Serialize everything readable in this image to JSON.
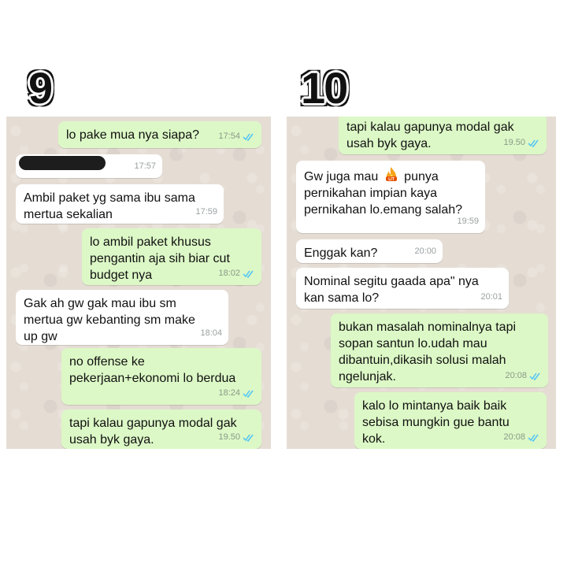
{
  "panels": [
    {
      "number": "9",
      "messages": [
        {
          "dir": "out",
          "text": "lo pake mua nya siapa?",
          "time": "17:54",
          "ticks": true
        },
        {
          "dir": "in",
          "text": "",
          "time": "17:57",
          "redacted": true
        },
        {
          "dir": "in",
          "text": "Ambil paket yg sama ibu sama\nmertua sekalian",
          "time": "17:59"
        },
        {
          "dir": "out",
          "text": "lo ambil paket khusus\npengantin aja sih biar cut\nbudget nya",
          "time": "18:02",
          "ticks": true
        },
        {
          "dir": "in",
          "text": "Gak ah gw gak mau ibu sm\nmertua gw kebanting sm make\nup gw",
          "time": "18:04"
        },
        {
          "dir": "out",
          "text": "no offense ke\npekerjaan+ekonomi lo berdua",
          "time": "18:24",
          "ticks": true
        },
        {
          "dir": "out",
          "text": "tapi kalau gapunya modal gak\nusah byk gaya.",
          "time": "19.50",
          "ticks": true
        }
      ]
    },
    {
      "number": "10",
      "messages": [
        {
          "dir": "out",
          "text": "tapi kalau gapunya modal gak\nusah byk gaya.",
          "time": "19.50",
          "ticks": true
        },
        {
          "dir": "in",
          "text_before_icon": "Gw juga mau ",
          "icon": "lit-fire-icon",
          "text_after_icon": " punya\npernikahan impian kaya\npernikahan lo.emang salah?",
          "time": "19:59"
        },
        {
          "dir": "in",
          "text": "Enggak kan?",
          "time": "20:00"
        },
        {
          "dir": "in",
          "text": "Nominal segitu gaada apa\" nya\nkan sama lo?",
          "time": "20:01"
        },
        {
          "dir": "out",
          "text": "bukan masalah nominalnya tapi\nsopan santun lo.udah mau\ndibantuin,dikasih solusi malah\nngelunjak.",
          "time": "20:08",
          "ticks": true
        },
        {
          "dir": "out",
          "text": "kalo lo mintanya baik baik\nsebisa mungkin gue bantu\nkok.",
          "time": "20:08",
          "ticks": true
        }
      ]
    }
  ],
  "colors": {
    "chat_bg": "#e5ddd4",
    "incoming_bubble": "#ffffff",
    "outgoing_bubble": "#dcf8c6",
    "read_ticks": "#4fc3f7",
    "lit_badge": "#f7a21b"
  }
}
